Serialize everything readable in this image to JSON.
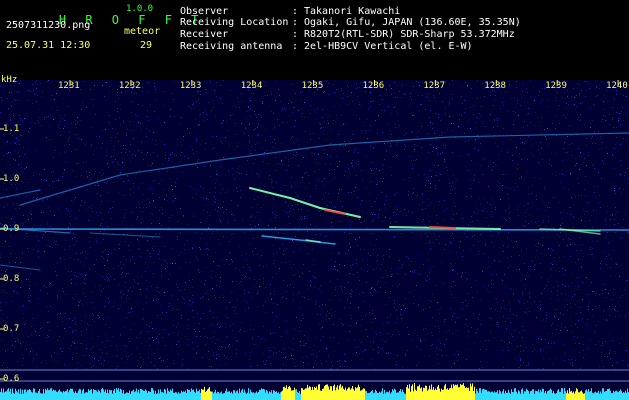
{
  "header": {
    "app_title": "H R O F F T",
    "version": "1.0.0",
    "filename": "2507311230.png",
    "datetime": "25.07.31 12:30",
    "meteor_label": "meteor",
    "meteor_count": "29",
    "fields": [
      {
        "label": "Observer",
        "sep": ":",
        "value": "Takanori Kawachi"
      },
      {
        "label": "Receiving Location",
        "sep": ":",
        "value": "Ogaki, Gifu, JAPAN (136.60E, 35.35N)"
      },
      {
        "label": "Receiver",
        "sep": ":",
        "value": "R820T2(RTL-SDR) SDR-Sharp 53.372MHz"
      },
      {
        "label": "Receiving antenna",
        "sep": ":",
        "value": "2el-HB9CV Vertical (el. E-W)"
      }
    ]
  },
  "chart_data": {
    "type": "heatmap",
    "yunit": "kHz",
    "x_ticks": [
      "1231",
      "1232",
      "1233",
      "1234",
      "1235",
      "1236",
      "1237",
      "1238",
      "1239",
      "1240"
    ],
    "y_ticks": [
      "1.1",
      "1.0",
      "0.9",
      "0.8",
      "0.7",
      "0.6"
    ],
    "ylim": [
      0.6,
      1.1
    ],
    "colors": {
      "background": "#000033",
      "noise": "#1a2aa8",
      "signal_low": "#2fb0ff",
      "signal_mid": "#7cffb0",
      "signal_high": "#ff4040",
      "histogram_cyan": "#33ddff",
      "histogram_yellow": "#ffff33"
    }
  }
}
